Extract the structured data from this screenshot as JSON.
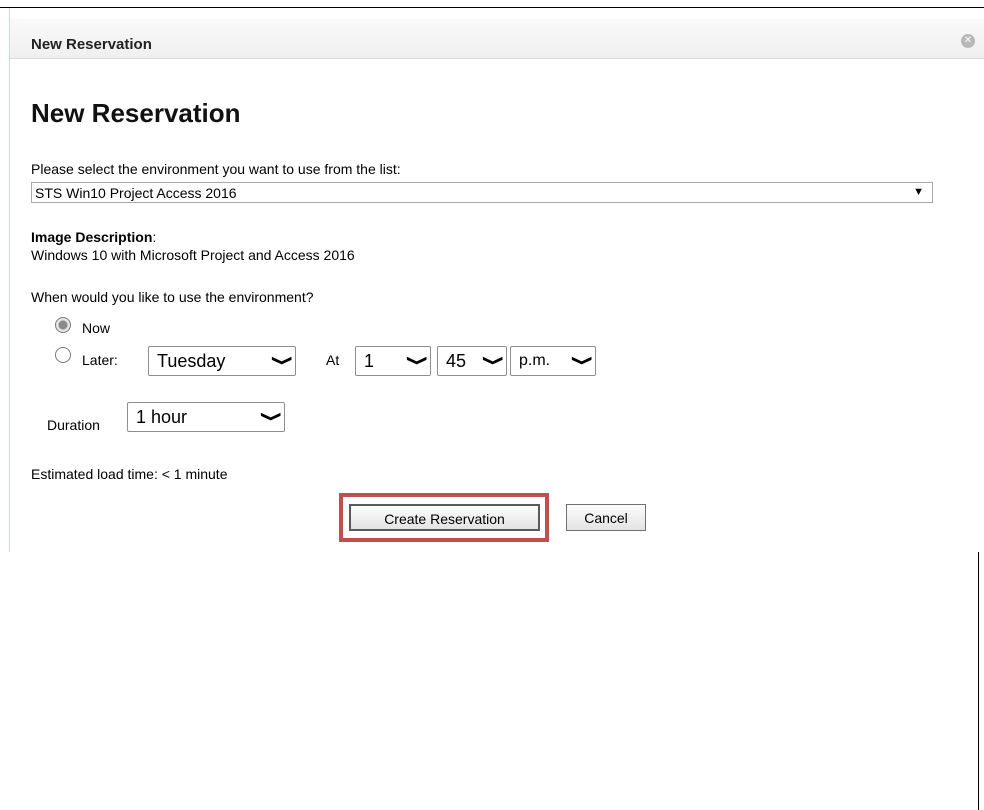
{
  "dialog": {
    "title": "New Reservation"
  },
  "page": {
    "title": "New Reservation",
    "environment_prompt": "Please select the environment you want to use from the list:",
    "environment_selected": "STS Win10 Project Access 2016",
    "description_label": "Image Description",
    "description_colon": ":",
    "description_text": "Windows 10 with Microsoft Project and Access 2016",
    "when_prompt": "When would you like to use the environment?",
    "now_label": "Now",
    "later_label": "Later:",
    "day_value": "Tuesday",
    "at_label": "At",
    "hour_value": "1",
    "minute_value": "45",
    "ampm_value": "p.m.",
    "duration_label": "Duration",
    "duration_value": "1 hour",
    "load_time": "Estimated load time: < 1 minute"
  },
  "buttons": {
    "create": "Create Reservation",
    "cancel": "Cancel"
  },
  "state": {
    "when": "now"
  },
  "colors": {
    "highlight": "#c0504d",
    "dialog_border": "#c9dbe8"
  },
  "icons": {
    "close": "close-icon",
    "dropdown": "chevron-down-icon"
  }
}
